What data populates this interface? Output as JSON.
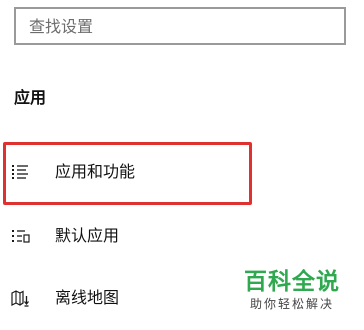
{
  "search": {
    "placeholder": "查找设置",
    "value": ""
  },
  "section": {
    "heading": "应用"
  },
  "nav_items": [
    {
      "id": "apps-features",
      "label": "应用和功能",
      "icon": "list-icon",
      "highlighted": true
    },
    {
      "id": "default-apps",
      "label": "默认应用",
      "icon": "default-apps-icon",
      "highlighted": false
    },
    {
      "id": "offline-maps",
      "label": "离线地图",
      "icon": "offline-map-icon",
      "highlighted": false
    }
  ],
  "highlight": {
    "color": "#e03131"
  },
  "watermark": {
    "main": "百科全说",
    "sub": "助你轻松解决",
    "color": "#2fa84f"
  }
}
